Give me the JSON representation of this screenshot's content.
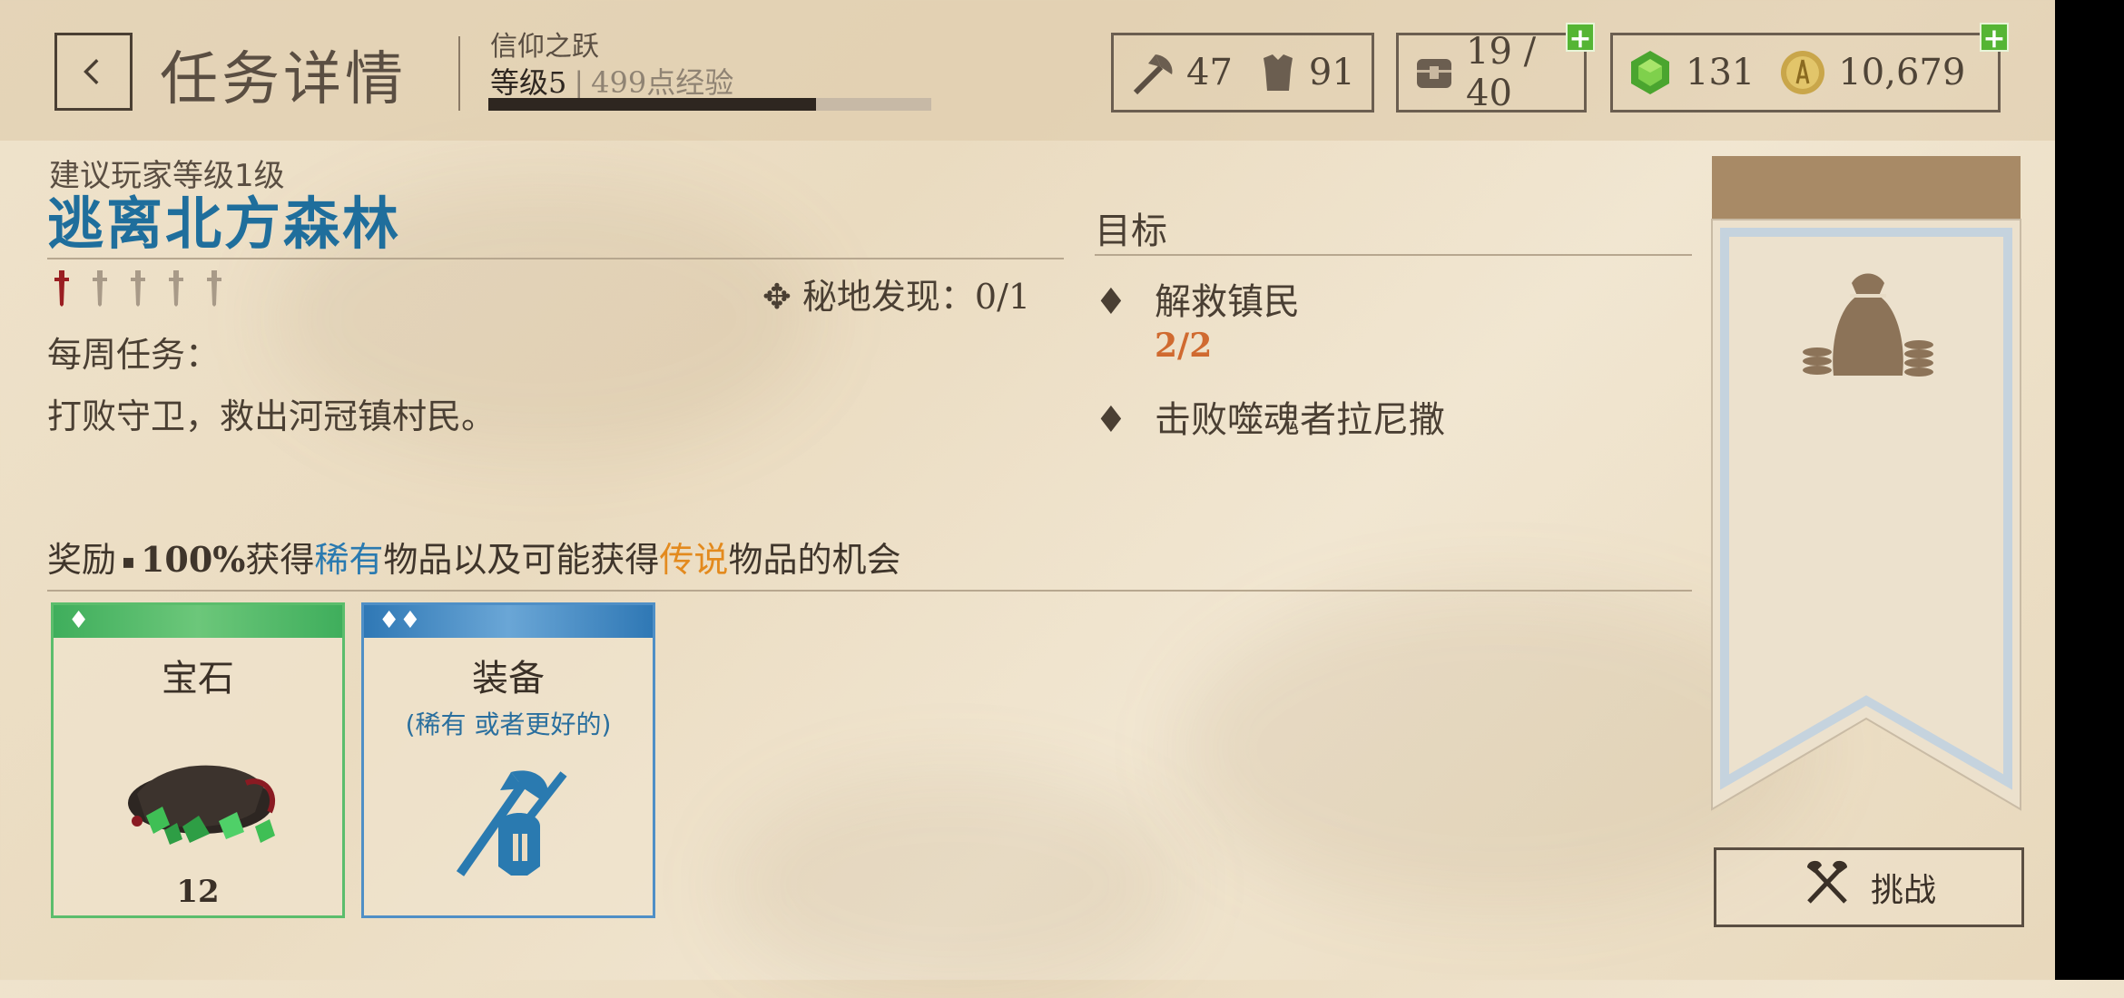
{
  "header": {
    "back_label": "<",
    "title": "任务详情",
    "faith_label": "信仰之跃",
    "level": "等级5",
    "exp": "499点经验",
    "xp_progress": 0.74
  },
  "resources": {
    "attack": "47",
    "defense": "91",
    "inventory": "19 / 40",
    "gems": "131",
    "gold": "10,679"
  },
  "mission": {
    "suggested_level": "建议玩家等级1级",
    "name": "逃离北方森林",
    "difficulty_filled": 1,
    "difficulty_total": 5,
    "secret_label": "✥ 秘地发现：",
    "secret_value": "0/1",
    "weekly_label": "每周任务：",
    "description": "打败守卫，救出河冠镇村民。"
  },
  "objectives": {
    "title": "目标",
    "items": [
      {
        "text": "解救镇民",
        "progress": "2/2"
      },
      {
        "text": "击败噬魂者拉尼撒",
        "progress": ""
      }
    ]
  },
  "rewards": {
    "prefix": "奖励",
    "pct": "100%",
    "t1": "获得",
    "rare": "稀有",
    "t2": "物品以及可能获得",
    "legend": "传说",
    "t3": "物品的机会",
    "cards": [
      {
        "title": "宝石",
        "subtitle": "",
        "count": "12",
        "band_color": "#3fae5c",
        "border_color": "#5bbd6c"
      },
      {
        "title": "装备",
        "subtitle": "(稀有 或者更好的)",
        "count": "",
        "band_color": "#2f78b5",
        "border_color": "#4f8fc6"
      }
    ]
  },
  "actions": {
    "challenge": "挑战"
  },
  "colors": {
    "accent_blue": "#1f6e9c",
    "orange": "#e38a1e",
    "progress_red": "#d06a30",
    "plus_green": "#55b534"
  }
}
